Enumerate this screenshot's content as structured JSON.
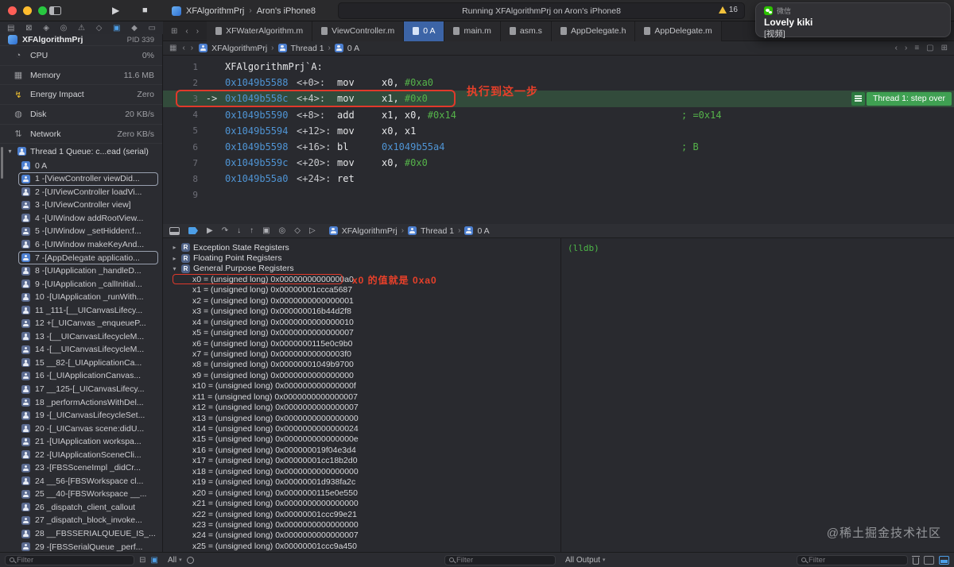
{
  "colors": {
    "accent_blue": "#4d9fe8",
    "address_blue": "#4f94d4",
    "immediate_green": "#55b34a",
    "annotation_red": "#e8402a",
    "exec_badge_green": "#3fa052",
    "tab_active_blue": "#3c64a6",
    "wechat_green": "#2dc100",
    "warning_yellow": "#f3c23c"
  },
  "toolbar": {
    "scheme_app": "XFAlgorithmPrj",
    "scheme_device": "Aron's iPhone8",
    "status_text": "Running XFAlgorithmPrj on Aron's iPhone8",
    "warning_count": "16"
  },
  "notification": {
    "app_name": "微信",
    "title": "Lovely kiki",
    "body": "[视频]"
  },
  "navigator_icons": [
    {
      "name": "project-navigator-icon",
      "glyph": "▤"
    },
    {
      "name": "source-control-icon",
      "glyph": "⊠"
    },
    {
      "name": "symbols-icon",
      "glyph": "◈"
    },
    {
      "name": "find-icon",
      "glyph": "◎"
    },
    {
      "name": "issues-icon",
      "glyph": "⚠"
    },
    {
      "name": "tests-icon",
      "glyph": "◇"
    },
    {
      "name": "debug-navigator-icon",
      "glyph": "▣",
      "active": true
    },
    {
      "name": "breakpoints-icon",
      "glyph": "◆"
    },
    {
      "name": "reports-icon",
      "glyph": "▭"
    }
  ],
  "tabs": {
    "active_index": 2,
    "items": [
      {
        "label": "XFWaterAlgorithm.m"
      },
      {
        "label": "ViewController.m"
      },
      {
        "label": "0 A"
      },
      {
        "label": "main.m"
      },
      {
        "label": "asm.s"
      },
      {
        "label": "AppDelegate.h"
      },
      {
        "label": "AppDelegate.m"
      }
    ]
  },
  "jump_bar": {
    "crumbs": [
      "XFAlgorithmPrj",
      "Thread 1",
      "0 A"
    ]
  },
  "debug_bar": {
    "crumbs": [
      "XFAlgorithmPrj",
      "Thread 1",
      "0 A"
    ]
  },
  "sidebar": {
    "process": {
      "name": "XFAlgorithmPrj",
      "pid": "PID 339"
    },
    "gauges": [
      {
        "icon": "cpu-gauge-icon",
        "glyph": "◔",
        "label": "CPU",
        "value": "0%"
      },
      {
        "icon": "memory-gauge-icon",
        "glyph": "▦",
        "label": "Memory",
        "value": "11.6 MB"
      },
      {
        "icon": "energy-gauge-icon",
        "glyph": "↯",
        "label": "Energy Impact",
        "value": "Zero"
      },
      {
        "icon": "disk-gauge-icon",
        "glyph": "◍",
        "label": "Disk",
        "value": "20 KB/s"
      },
      {
        "icon": "network-gauge-icon",
        "glyph": "⇅",
        "label": "Network",
        "value": "Zero KB/s"
      }
    ],
    "thread_header": "Thread 1 Queue: c...ead (serial)",
    "frames": [
      {
        "label": "0 A",
        "user": true
      },
      {
        "label": "1 -[ViewController viewDid...",
        "user": true,
        "boxed": true
      },
      {
        "label": "2 -[UIViewController loadVi..."
      },
      {
        "label": "3 -[UIViewController view]"
      },
      {
        "label": "4 -[UIWindow addRootView..."
      },
      {
        "label": "5 -[UIWindow _setHidden:f..."
      },
      {
        "label": "6 -[UIWindow makeKeyAnd..."
      },
      {
        "label": "7 -[AppDelegate applicatio...",
        "user": true,
        "boxed": true
      },
      {
        "label": "8 -[UIApplication _handleD..."
      },
      {
        "label": "9 -[UIApplication _callInitial..."
      },
      {
        "label": "10 -[UIApplication _runWith..."
      },
      {
        "label": "11 _111-[__UICanvasLifecy..."
      },
      {
        "label": "12 +[_UICanvas _enqueueP..."
      },
      {
        "label": "13 -[__UICanvasLifecycleM..."
      },
      {
        "label": "14 -[__UICanvasLifecycleM..."
      },
      {
        "label": "15 __82-[_UIApplicationCa..."
      },
      {
        "label": "16 -[_UIApplicationCanvas..."
      },
      {
        "label": "17 __125-[_UICanvasLifecy..."
      },
      {
        "label": "18 _performActionsWithDel..."
      },
      {
        "label": "19 -[_UICanvasLifecycleSet..."
      },
      {
        "label": "20 -[_UICanvas scene:didU..."
      },
      {
        "label": "21 -[UIApplication workspa..."
      },
      {
        "label": "22 -[UIApplicationSceneCli..."
      },
      {
        "label": "23 -[FBSSceneImpl _didCr..."
      },
      {
        "label": "24 __56-[FBSWorkspace cl..."
      },
      {
        "label": "25 __40-[FBSWorkspace __..."
      },
      {
        "label": "26 _dispatch_client_callout"
      },
      {
        "label": "27 _dispatch_block_invoke..."
      },
      {
        "label": "28 __FBSSERIALQUEUE_IS_..."
      },
      {
        "label": "29 -[FBSSerialQueue _perf..."
      }
    ]
  },
  "editor": {
    "badge": "Thread 1: step over",
    "lines": [
      {
        "n": 1,
        "text": "XFAlgorithmPrj`A:"
      },
      {
        "n": 2,
        "addr": "0x1049b5588",
        "off": "<+0>:",
        "mn": "mov",
        "ops": "x0, ",
        "imm": "#0xa0"
      },
      {
        "n": 3,
        "current": true,
        "addr": "0x1049b558c",
        "off": "<+4>:",
        "mn": "mov",
        "ops": "x1, ",
        "imm": "#0x0"
      },
      {
        "n": 4,
        "addr": "0x1049b5590",
        "off": "<+8>:",
        "mn": "add",
        "ops": "x1, x0, ",
        "imm": "#0x14",
        "comment": "; =0x14"
      },
      {
        "n": 5,
        "addr": "0x1049b5594",
        "off": "<+12>:",
        "mn": "mov",
        "ops": "x0, x1"
      },
      {
        "n": 6,
        "addr": "0x1049b5598",
        "off": "<+16>:",
        "mn": "bl",
        "target": "0x1049b55a4",
        "comment": "; B"
      },
      {
        "n": 7,
        "addr": "0x1049b559c",
        "off": "<+20>:",
        "mn": "mov",
        "ops": "x0, ",
        "imm": "#0x0"
      },
      {
        "n": 8,
        "addr": "0x1049b55a0",
        "off": "<+24>:",
        "mn": "ret"
      },
      {
        "n": 9
      }
    ]
  },
  "annotations": {
    "line_note": "执行到这一步",
    "register_note": "x0 的值就是 0xa0"
  },
  "registers": {
    "type_label": "(unsigned long)",
    "sections": [
      {
        "label": "Exception State Registers",
        "expanded": false
      },
      {
        "label": "Floating Point Registers",
        "expanded": false
      },
      {
        "label": "General Purpose Registers",
        "expanded": true,
        "registers": [
          {
            "name": "x0",
            "value": "0x00000000000000a0",
            "highlight": true
          },
          {
            "name": "x1",
            "value": "0x00000001ccca5687"
          },
          {
            "name": "x2",
            "value": "0x0000000000000001"
          },
          {
            "name": "x3",
            "value": "0x000000016b44d2f8"
          },
          {
            "name": "x4",
            "value": "0x0000000000000010"
          },
          {
            "name": "x5",
            "value": "0x0000000000000007"
          },
          {
            "name": "x6",
            "value": "0x0000000115e0c9b0"
          },
          {
            "name": "x7",
            "value": "0x00000000000003f0"
          },
          {
            "name": "x8",
            "value": "0x00000001049b9700"
          },
          {
            "name": "x9",
            "value": "0x0000000000000000"
          },
          {
            "name": "x10",
            "value": "0x000000000000000f"
          },
          {
            "name": "x11",
            "value": "0x0000000000000007"
          },
          {
            "name": "x12",
            "value": "0x0000000000000007"
          },
          {
            "name": "x13",
            "value": "0x0000000000000000"
          },
          {
            "name": "x14",
            "value": "0x0000000000000024"
          },
          {
            "name": "x15",
            "value": "0x000000000000000e"
          },
          {
            "name": "x16",
            "value": "0x000000019f04e3d4"
          },
          {
            "name": "x17",
            "value": "0x00000001cc18b2d0"
          },
          {
            "name": "x18",
            "value": "0x0000000000000000"
          },
          {
            "name": "x19",
            "value": "0x00000001d938fa2c"
          },
          {
            "name": "x20",
            "value": "0x0000000115e0e550"
          },
          {
            "name": "x21",
            "value": "0x0000000000000000"
          },
          {
            "name": "x22",
            "value": "0x00000001ccc99e21"
          },
          {
            "name": "x23",
            "value": "0x0000000000000000"
          },
          {
            "name": "x24",
            "value": "0x0000000000000007"
          },
          {
            "name": "x25",
            "value": "0x00000001ccc9a450"
          }
        ]
      }
    ]
  },
  "console": {
    "prompt": "(lldb)",
    "watermark": "@稀土掘金技术社区"
  },
  "filter_bars": {
    "sidebar_placeholder": "Filter",
    "vars_scope": "All",
    "vars_placeholder": "Filter",
    "console_scope": "All Output",
    "console_placeholder": "Filter"
  }
}
